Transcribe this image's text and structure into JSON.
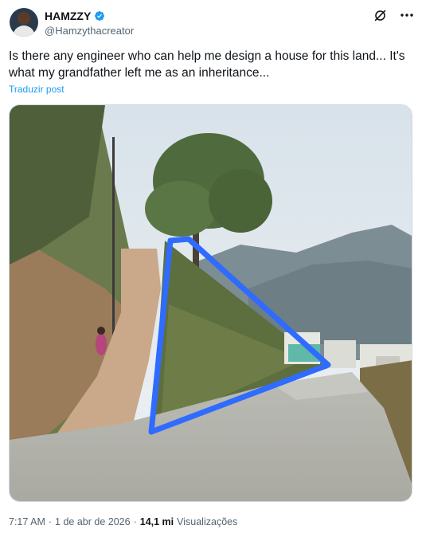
{
  "author": {
    "name": "HAMZZY",
    "handle": "@Hamzythacreator",
    "verified": true
  },
  "icons": {
    "verified": "verified-badge-icon",
    "grok": "grok-icon",
    "more": "more-options-icon"
  },
  "post": {
    "text": "Is there any engineer who can help me design a house for this land... It's what my grandfather left me as an inheritance...",
    "translate_label": "Traduzir post"
  },
  "media": {
    "type": "photo"
  },
  "meta": {
    "time": "7:17 AM",
    "separator1": "·",
    "date": "1 de abr de 2026",
    "separator2": "·",
    "views_count": "14,1 mi",
    "views_label": "Visualizações"
  },
  "colors": {
    "accent": "#1d9bf0",
    "annotation": "#2f6bff",
    "muted_text": "#536471"
  }
}
